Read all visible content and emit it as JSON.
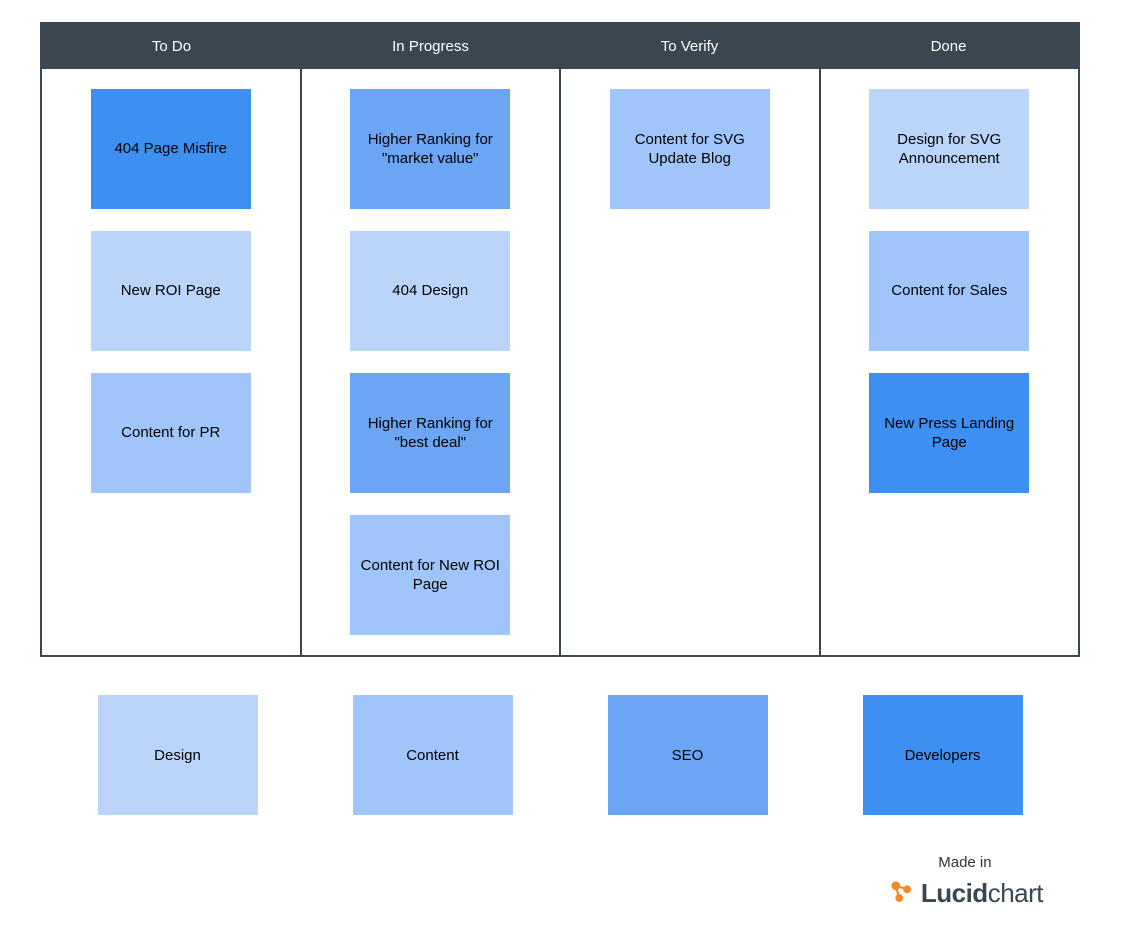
{
  "colors": {
    "design": "#bbd4fa",
    "content": "#a0c5fa",
    "seo": "#6ba5f3",
    "developers": "#3d90f2"
  },
  "columns": [
    {
      "title": "To Do",
      "cards": [
        {
          "label": "404 Page Misfire",
          "category": "developers"
        },
        {
          "label": "New ROI Page",
          "category": "design"
        },
        {
          "label": "Content for PR",
          "category": "content"
        }
      ]
    },
    {
      "title": "In Progress",
      "cards": [
        {
          "label": "Higher Ranking for \"market value\"",
          "category": "seo"
        },
        {
          "label": "404 Design",
          "category": "design"
        },
        {
          "label": "Higher Ranking for \"best deal\"",
          "category": "seo"
        },
        {
          "label": "Content for New ROI Page",
          "category": "content"
        }
      ]
    },
    {
      "title": "To Verify",
      "cards": [
        {
          "label": "Content for SVG Update Blog",
          "category": "content"
        }
      ]
    },
    {
      "title": "Done",
      "cards": [
        {
          "label": "Design for SVG Announcement",
          "category": "design"
        },
        {
          "label": "Content for Sales",
          "category": "content"
        },
        {
          "label": "New Press Landing Page",
          "category": "developers"
        }
      ]
    }
  ],
  "legend": [
    {
      "label": "Design",
      "category": "design"
    },
    {
      "label": "Content",
      "category": "content"
    },
    {
      "label": "SEO",
      "category": "seo"
    },
    {
      "label": "Developers",
      "category": "developers"
    }
  ],
  "branding": {
    "made_in": "Made in",
    "brand_bold": "Lucid",
    "brand_light": "chart"
  }
}
